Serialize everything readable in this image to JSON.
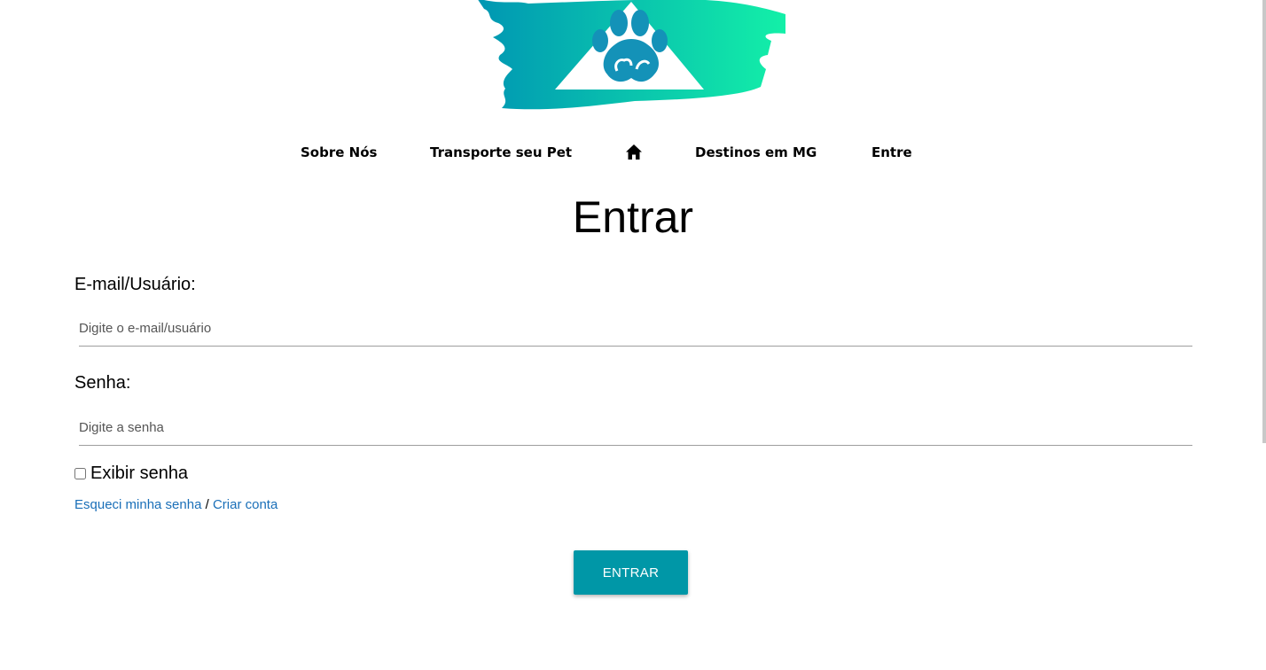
{
  "brand": {
    "logo_icon": "paw-triangle-logo",
    "gradient_start": "#0096b3",
    "gradient_end": "#13f0a8",
    "paw_color": "#1492b8"
  },
  "nav": {
    "items": [
      {
        "label": "Sobre Nós"
      },
      {
        "label": "Transporte seu Pet"
      },
      {
        "label": "Destinos em MG"
      },
      {
        "label": "Entre"
      }
    ],
    "home_icon": "home-icon"
  },
  "login": {
    "title": "Entrar",
    "email_label": "E-mail/Usuário:",
    "email_placeholder": "Digite o e-mail/usuário",
    "email_value": "",
    "password_label": "Senha:",
    "password_placeholder": "Digite a senha",
    "password_value": "",
    "show_password_label": "Exibir senha",
    "show_password_checked": false,
    "forgot_link": "Esqueci minha senha",
    "separator": "/",
    "create_account_link": "Criar conta",
    "submit_label": "ENTRAR",
    "submit_color": "#0097a7",
    "link_color": "#1a6fb8"
  }
}
